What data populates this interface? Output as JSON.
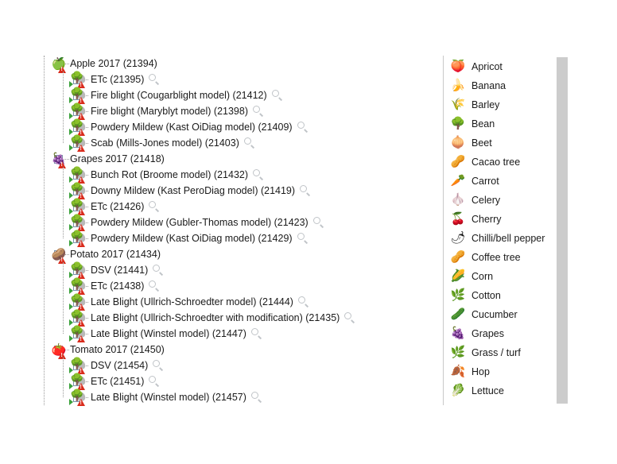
{
  "tree": {
    "groups": [
      {
        "id": "apple-2017",
        "label": "Apple 2017 (21394)",
        "icon": "apple-icon",
        "glyph": "🍏",
        "expanded": true,
        "expander": "minus",
        "children": [
          {
            "id": "apple-etc",
            "label": "ETc (21395)",
            "icon": "model-icon",
            "expander": "plus",
            "magnifier": true
          },
          {
            "id": "apple-fb-cougar",
            "label": "Fire blight (Cougarblight model) (21412)",
            "icon": "model-icon",
            "expander": "plus",
            "magnifier": true
          },
          {
            "id": "apple-fb-mary",
            "label": "Fire blight (Maryblyt model) (21398)",
            "icon": "model-icon",
            "expander": "plus",
            "magnifier": true
          },
          {
            "id": "apple-pm-kast",
            "label": "Powdery Mildew (Kast OiDiag model) (21409)",
            "icon": "model-icon",
            "expander": "plus",
            "magnifier": true
          },
          {
            "id": "apple-scab",
            "label": "Scab (Mills-Jones model) (21403)",
            "icon": "model-icon",
            "expander": "plus",
            "magnifier": true
          }
        ]
      },
      {
        "id": "grapes-2017",
        "label": "Grapes 2017 (21418)",
        "icon": "grapes-icon",
        "glyph": "🍇",
        "expanded": true,
        "expander": "minus",
        "children": [
          {
            "id": "grapes-bunch-rot",
            "label": "Bunch Rot (Broome model) (21432)",
            "icon": "model-icon",
            "expander": "plus",
            "magnifier": true
          },
          {
            "id": "grapes-downy",
            "label": "Downy Mildew (Kast PeroDiag model) (21419)",
            "icon": "model-icon",
            "expander": "plus",
            "magnifier": true
          },
          {
            "id": "grapes-etc",
            "label": "ETc (21426)",
            "icon": "model-icon",
            "expander": "plus",
            "magnifier": true
          },
          {
            "id": "grapes-pm-gubler",
            "label": "Powdery Mildew (Gubler-Thomas model) (21423)",
            "icon": "model-icon",
            "expander": "plus",
            "magnifier": true
          },
          {
            "id": "grapes-pm-kast",
            "label": "Powdery Mildew (Kast OiDiag model) (21429)",
            "icon": "model-icon",
            "expander": "plus",
            "magnifier": true
          }
        ]
      },
      {
        "id": "potato-2017",
        "label": "Potato 2017 (21434)",
        "icon": "potato-icon",
        "glyph": "🥔",
        "expanded": true,
        "expander": "minus",
        "children": [
          {
            "id": "potato-dsv",
            "label": "DSV (21441)",
            "icon": "model-icon",
            "expander": "plus",
            "magnifier": true
          },
          {
            "id": "potato-etc",
            "label": "ETc (21438)",
            "icon": "model-icon",
            "expander": "plus",
            "magnifier": true
          },
          {
            "id": "potato-lb-us",
            "label": "Late Blight (Ullrich-Schroedter model) (21444)",
            "icon": "model-icon",
            "expander": "plus",
            "magnifier": true
          },
          {
            "id": "potato-lb-us-mod",
            "label": "Late Blight (Ullrich-Schroedter with modification) (21435)",
            "icon": "model-icon",
            "expander": "plus",
            "magnifier": true
          },
          {
            "id": "potato-lb-winstel",
            "label": "Late Blight (Winstel model) (21447)",
            "icon": "model-icon",
            "expander": "plus",
            "magnifier": true
          }
        ]
      },
      {
        "id": "tomato-2017",
        "label": "Tomato 2017 (21450)",
        "icon": "tomato-icon",
        "glyph": "🍅",
        "expanded": true,
        "expander": "minus",
        "children": [
          {
            "id": "tomato-dsv",
            "label": "DSV (21454)",
            "icon": "model-icon",
            "expander": "plus",
            "magnifier": true
          },
          {
            "id": "tomato-etc",
            "label": "ETc (21451)",
            "icon": "model-icon",
            "expander": "plus",
            "magnifier": true
          },
          {
            "id": "tomato-lb-winstel",
            "label": "Late Blight (Winstel model) (21457)",
            "icon": "model-icon",
            "expander": "plus",
            "magnifier": true
          }
        ]
      }
    ]
  },
  "crop_list": {
    "items": [
      {
        "id": "apricot",
        "label": "Apricot",
        "icon": "apricot-icon",
        "glyph": "🍑"
      },
      {
        "id": "banana",
        "label": "Banana",
        "icon": "banana-icon",
        "glyph": "🍌"
      },
      {
        "id": "barley",
        "label": "Barley",
        "icon": "barley-icon",
        "glyph": "🌾"
      },
      {
        "id": "bean",
        "label": "Bean",
        "icon": "bean-icon",
        "glyph": "🌳"
      },
      {
        "id": "beet",
        "label": "Beet",
        "icon": "beet-icon",
        "glyph": "🧅"
      },
      {
        "id": "cacao-tree",
        "label": "Cacao tree",
        "icon": "cacao-tree-icon",
        "glyph": "🥜"
      },
      {
        "id": "carrot",
        "label": "Carrot",
        "icon": "carrot-icon",
        "glyph": "🥕"
      },
      {
        "id": "celery",
        "label": "Celery",
        "icon": "celery-icon",
        "glyph": "🧄"
      },
      {
        "id": "cherry",
        "label": "Cherry",
        "icon": "cherry-icon",
        "glyph": "🍒"
      },
      {
        "id": "chilli-pepper",
        "label": "Chilli/bell pepper",
        "icon": "chilli-pepper-icon",
        "glyph": "🌶"
      },
      {
        "id": "coffee-tree",
        "label": "Coffee tree",
        "icon": "coffee-tree-icon",
        "glyph": "🥜"
      },
      {
        "id": "corn",
        "label": "Corn",
        "icon": "corn-icon",
        "glyph": "🌽"
      },
      {
        "id": "cotton",
        "label": "Cotton",
        "icon": "cotton-icon",
        "glyph": "🌿"
      },
      {
        "id": "cucumber",
        "label": "Cucumber",
        "icon": "cucumber-icon",
        "glyph": "🥒"
      },
      {
        "id": "grapes",
        "label": "Grapes",
        "icon": "grapes-icon",
        "glyph": "🍇"
      },
      {
        "id": "grass-turf",
        "label": "Grass / turf",
        "icon": "grass-icon",
        "glyph": "🌿"
      },
      {
        "id": "hop",
        "label": "Hop",
        "icon": "hop-icon",
        "glyph": "🍂"
      },
      {
        "id": "lettuce",
        "label": "Lettuce",
        "icon": "lettuce-icon",
        "glyph": "🥬"
      }
    ]
  },
  "colors": {
    "warning": "#d92b1c",
    "tree_green": "#3aa13a",
    "expander_border": "#7c93ab",
    "scrollbar": "#cccccc",
    "text": "#1a1a1a"
  }
}
